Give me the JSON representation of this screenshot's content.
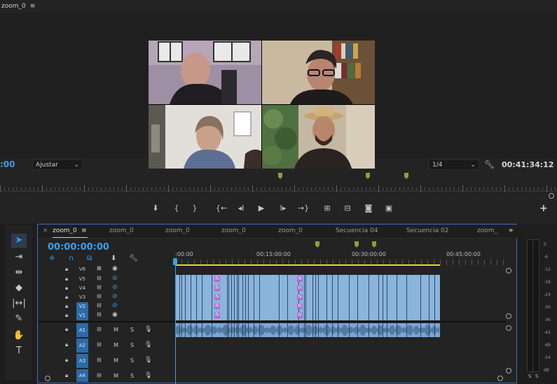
{
  "monitor": {
    "title": "zoom_0",
    "menu_icon": "hamburger-icon",
    "timecode_left": ":00",
    "fit_label": "Ajustar",
    "resolution": "1/4",
    "timecode_right": "00:41:34:12"
  },
  "transport": {
    "icons": [
      "marker-icon",
      "mark-in-icon",
      "mark-out-icon",
      "go-to-in-icon",
      "step-back-icon",
      "play-icon",
      "step-forward-icon",
      "go-to-out-icon",
      "lift-icon",
      "extract-icon",
      "camera-icon",
      "compare-icon",
      "add-icon"
    ]
  },
  "tools": {
    "items": [
      "selection-tool-icon",
      "track-select-icon",
      "ripple-edit-icon",
      "razor-icon",
      "slip-icon",
      "pen-icon",
      "hand-icon",
      "type-icon"
    ]
  },
  "timeline": {
    "tabs": [
      "zoom_0",
      "zoom_0",
      "zoom_0",
      "zoom_0",
      "zoom_0",
      "Secuencia 04",
      "Secuencia 02",
      "zoom_"
    ],
    "timecode": "00:00:00:00",
    "ruler_labels": [
      ":00:00",
      "00:15:00:00",
      "00:30:00:00",
      "00:45:00:00"
    ],
    "video_tracks": [
      "V6",
      "V5",
      "V4",
      "V3",
      "V2",
      "V1"
    ],
    "audio_tracks": [
      "A1",
      "A2",
      "A3",
      "A4"
    ],
    "track_mute": "M",
    "track_solo": "S",
    "fx_label": "fx"
  },
  "meter": {
    "db_labels": [
      "0",
      "-6",
      "-12",
      "-18",
      "-24",
      "-30",
      "-36",
      "-42",
      "-48",
      "-54",
      "dB"
    ],
    "solo_left": "S",
    "solo_right": "S"
  }
}
